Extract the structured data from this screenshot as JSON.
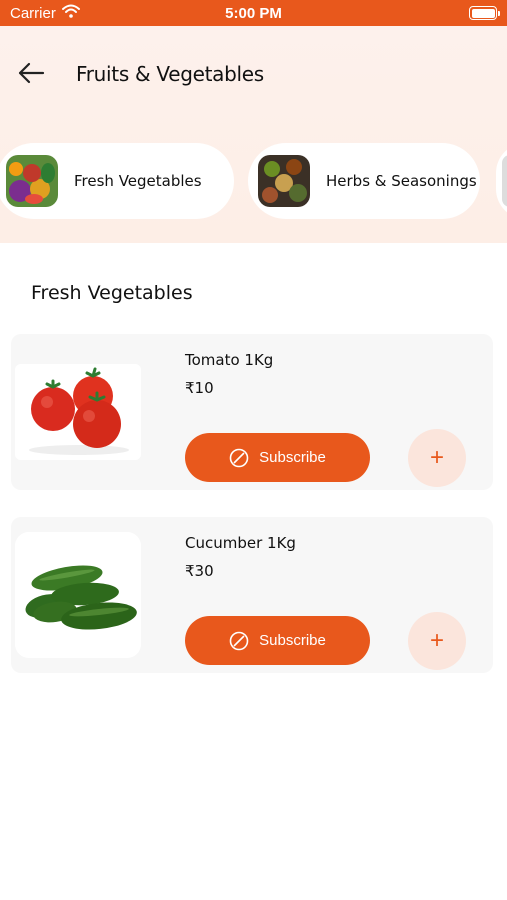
{
  "status_bar": {
    "carrier": "Carrier",
    "time": "5:00 PM"
  },
  "header": {
    "title": "Fruits & Vegetables"
  },
  "categories": [
    {
      "label": "Fresh Vegetables",
      "icon": "vegetables-image"
    },
    {
      "label": "Herbs & Seasonings",
      "icon": "herbs-image"
    }
  ],
  "section": {
    "title": "Fresh Vegetables"
  },
  "products": [
    {
      "name": "Tomato 1Kg",
      "price": "₹10",
      "subscribe_label": "Subscribe",
      "add_label": "+",
      "image": "tomato-image"
    },
    {
      "name": "Cucumber 1Kg",
      "price": "₹30",
      "subscribe_label": "Subscribe",
      "add_label": "+",
      "image": "cucumber-image"
    }
  ],
  "colors": {
    "accent": "#e8581c",
    "header_bg": "#fdf1ec",
    "card_bg": "#f7f7f7",
    "add_bg": "#fbe5dc"
  }
}
